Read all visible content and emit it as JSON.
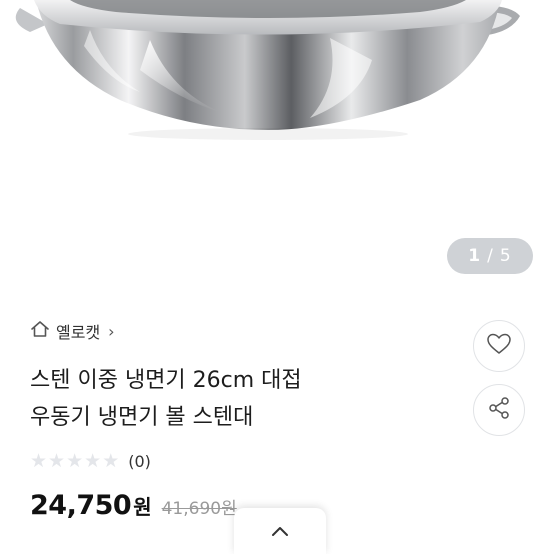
{
  "product_image": {
    "counter_current": "1",
    "counter_separator": "/",
    "counter_total": "5"
  },
  "store": {
    "name": "옐로캣",
    "chevron": "›"
  },
  "product": {
    "title_line1": "스텐 이중 냉면기 26cm 대접",
    "title_line2": "우동기 냉면기 볼 스텐대",
    "rating_stars": 0,
    "review_count": "(0)",
    "price": "24,750",
    "price_unit": "원",
    "original_price": "41,690원"
  },
  "icons": {
    "store": "home-icon",
    "wish": "heart-icon",
    "share": "share-icon",
    "scroll": "chevron-up-icon"
  },
  "colors": {
    "counter_bg": "#cfd2d6",
    "star_empty": "#e4e6ea",
    "original_price": "#9a9a9a"
  }
}
